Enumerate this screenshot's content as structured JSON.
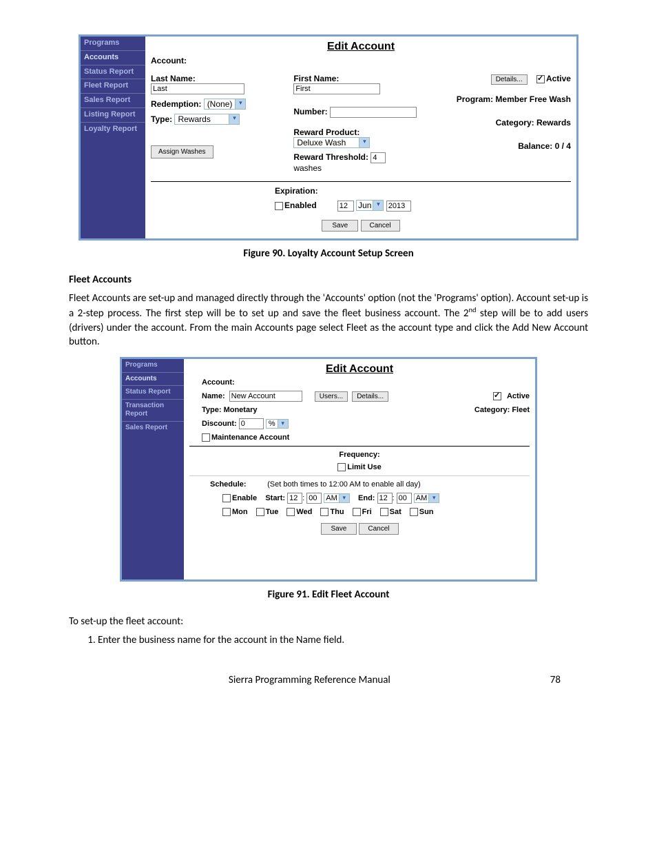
{
  "doc": {
    "fig90_caption": "Figure 90. Loyalty Account Setup Screen",
    "fleet_heading": "Fleet Accounts",
    "fleet_para": "Fleet Accounts are set-up and managed directly through the 'Accounts' option (not the 'Programs' option). Account set-up is a 2-step process. The first step will be to set up and save the fleet business account. The 2",
    "fleet_para_sup": "nd",
    "fleet_para_tail": " step will be to add users (drivers) under the account. From the main Accounts page select Fleet as the account type and click the Add New Account button.",
    "fig91_caption": "Figure 91. Edit Fleet Account",
    "setup_line": "To set-up the fleet account:",
    "step1": "Enter the business name for the account in the Name field.",
    "footer_title": "Sierra Programming Reference Manual",
    "footer_page": "78"
  },
  "ss1": {
    "title": "Edit Account",
    "sidebar": [
      "Programs",
      "Accounts",
      "Status Report",
      "Fleet Report",
      "Sales Report",
      "Listing Report",
      "Loyalty Report"
    ],
    "account_label": "Account:",
    "lastname_label": "Last Name:",
    "lastname_value": "Last",
    "firstname_label": "First Name:",
    "firstname_value": "First",
    "details_btn": "Details...",
    "active_label": "Active",
    "redemption_label": "Redemption:",
    "redemption_value": "(None)",
    "number_label": "Number:",
    "program_label": "Program: Member Free Wash",
    "type_label": "Type:",
    "type_value": "Rewards",
    "reward_product_label": "Reward Product:",
    "reward_product_value": "Deluxe Wash",
    "category_label": "Category: Rewards",
    "reward_threshold_label": "Reward Threshold:",
    "reward_threshold_value": "4",
    "reward_threshold_tail": "washes",
    "balance_label": "Balance: 0 / 4",
    "assign_btn": "Assign Washes",
    "expiration_label": "Expiration:",
    "enabled_label": "Enabled",
    "exp_day": "12",
    "exp_month": "Jun",
    "exp_year": "2013",
    "save_btn": "Save",
    "cancel_btn": "Cancel"
  },
  "ss2": {
    "title": "Edit Account",
    "sidebar": [
      "Programs",
      "Accounts",
      "Status Report",
      "Transaction Report",
      "Sales Report"
    ],
    "account_label": "Account:",
    "name_label": "Name:",
    "name_value": "New Account",
    "users_btn": "Users...",
    "details_btn": "Details...",
    "active_label": "Active",
    "type_label": "Type: Monetary",
    "category_label": "Category: Fleet",
    "discount_label": "Discount:",
    "discount_value": "0",
    "discount_unit": "%",
    "maint_label": "Maintenance Account",
    "freq_label": "Frequency:",
    "limit_label": "Limit Use",
    "schedule_label": "Schedule:",
    "schedule_hint": "(Set both times to 12:00 AM to enable all day)",
    "enable_label": "Enable",
    "start_label": "Start:",
    "start_h": "12",
    "start_m": "00",
    "start_ampm": "AM",
    "end_label": "End:",
    "end_h": "12",
    "end_m": "00",
    "end_ampm": "AM",
    "days": [
      "Mon",
      "Tue",
      "Wed",
      "Thu",
      "Fri",
      "Sat",
      "Sun"
    ],
    "save_btn": "Save",
    "cancel_btn": "Cancel"
  }
}
